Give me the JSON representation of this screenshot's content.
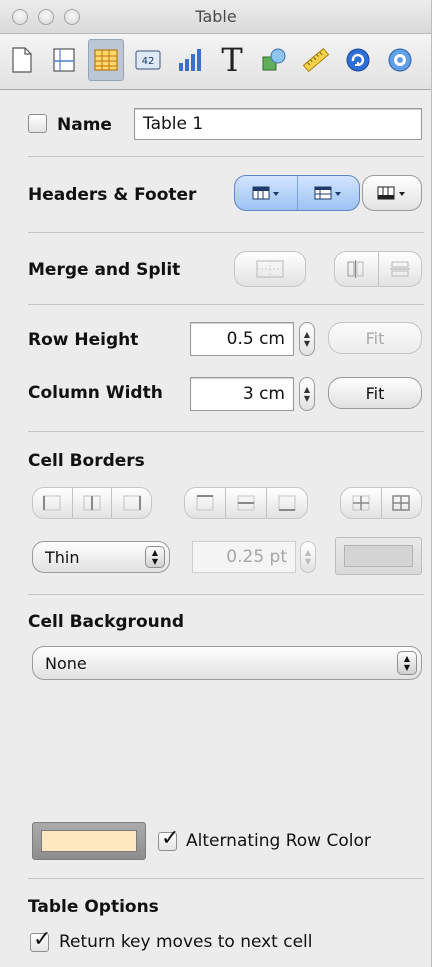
{
  "window": {
    "title": "Table"
  },
  "toolbar": {
    "tabs": [
      {
        "icon": "document-icon"
      },
      {
        "icon": "layout-icon"
      },
      {
        "icon": "table-icon",
        "active": true
      },
      {
        "icon": "format-icon",
        "label": "42"
      },
      {
        "icon": "chart-icon"
      },
      {
        "icon": "text-icon",
        "label": "T"
      },
      {
        "icon": "graphic-icon"
      },
      {
        "icon": "metrics-icon"
      },
      {
        "icon": "hyperlink-icon"
      },
      {
        "icon": "quicktime-icon"
      }
    ]
  },
  "name": {
    "label": "Name",
    "value": "Table 1",
    "checked": false
  },
  "headers_footer": {
    "label": "Headers & Footer"
  },
  "merge_split": {
    "label": "Merge and Split"
  },
  "row_height": {
    "label": "Row Height",
    "value": "0.5 cm",
    "fit_label": "Fit"
  },
  "column_width": {
    "label": "Column Width",
    "value": "3 cm",
    "fit_label": "Fit"
  },
  "cell_borders": {
    "label": "Cell Borders",
    "style": "Thin",
    "width": "0.25 pt"
  },
  "cell_background": {
    "label": "Cell Background",
    "fill": "None"
  },
  "alternating": {
    "label": "Alternating Row Color",
    "checked": true,
    "color": "#fde8c0"
  },
  "table_options": {
    "label": "Table Options",
    "return_key_label": "Return key moves to next cell",
    "return_key_checked": true
  },
  "colors": {
    "active_segment": "#9cc2f3",
    "panel": "#ececec"
  }
}
